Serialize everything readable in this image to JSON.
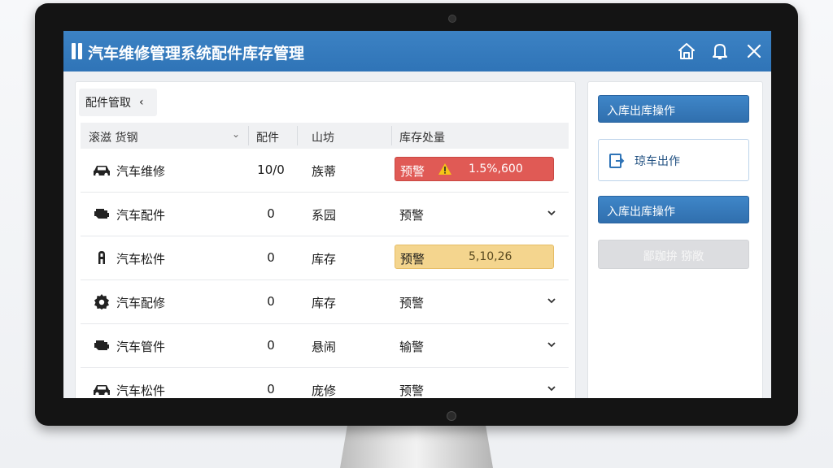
{
  "window": {
    "title": "汽车维修管理系统配件库存管理"
  },
  "titlebar_icons": [
    "home-icon",
    "bell-icon",
    "close-icon"
  ],
  "left_panel": {
    "header_label": "配件管取",
    "header_icon": "chevron-left-icon",
    "columns": [
      "滚滋 货钢",
      "配件",
      "山坊",
      "库存处量"
    ],
    "rows": [
      {
        "icon": "car-icon",
        "name": "汽车维修",
        "qty": "10/0",
        "status": "族蒂",
        "stock": {
          "type": "badge-red",
          "label": "预警",
          "warn_icon": true,
          "value": "1.5%,600"
        }
      },
      {
        "icon": "engine-icon",
        "name": "汽车配件",
        "qty": "0",
        "status": "系园",
        "stock": {
          "type": "text",
          "text": "预警"
        }
      },
      {
        "icon": "part-icon",
        "name": "汽车松件",
        "qty": "0",
        "status": "库存",
        "stock": {
          "type": "badge-yellow",
          "label": "预警",
          "value": "5,10,26"
        }
      },
      {
        "icon": "gear-icon",
        "name": "汽车配修",
        "qty": "0",
        "status": "库存",
        "stock": {
          "type": "text",
          "text": "预警"
        }
      },
      {
        "icon": "engine-icon",
        "name": "汽车管件",
        "qty": "0",
        "status": "悬闹",
        "stock": {
          "type": "text",
          "text": "输警"
        }
      },
      {
        "icon": "car-icon",
        "name": "汽车松件",
        "qty": "0",
        "status": "庞修",
        "stock": {
          "type": "text",
          "text": "预警"
        }
      }
    ]
  },
  "right_panel": {
    "btn_inout_1": "入库出库操作",
    "btn_outbound": "琼车出作",
    "btn_inout_2": "入库出库操作",
    "btn_disabled": "鄙跏拚 猕敞"
  },
  "colors": {
    "titlebar": "#2f74b7",
    "primary_button": "#3a7fc1",
    "badge_red": "#e05a55",
    "badge_yellow": "#f4d58e",
    "disabled": "#dcdde0"
  }
}
